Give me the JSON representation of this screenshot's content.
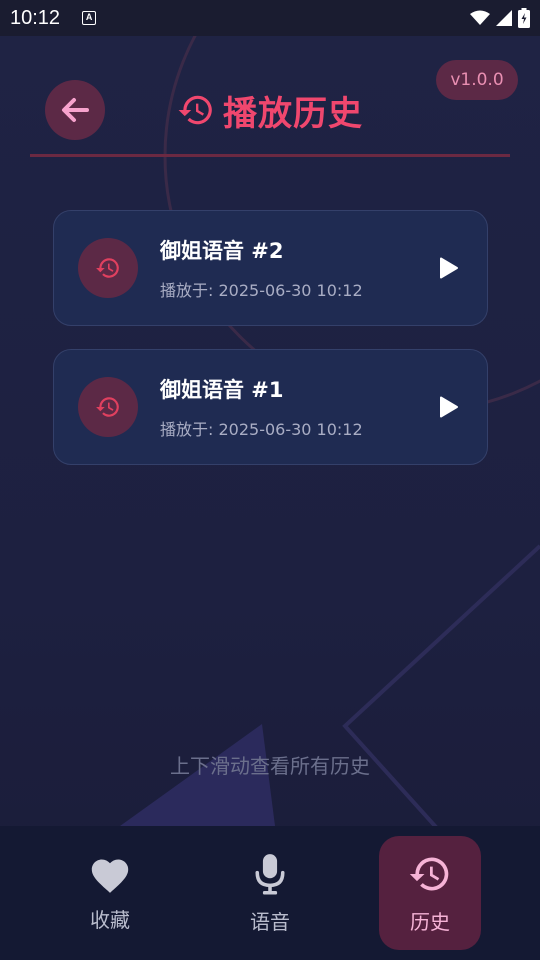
{
  "status_bar": {
    "time": "10:12",
    "a_glyph": "A",
    "icons": [
      "wifi-icon",
      "signal-icon",
      "battery-icon"
    ]
  },
  "header": {
    "title": "播放历史",
    "version": "v1.0.0",
    "back_icon": "arrow-left-icon",
    "title_icon": "history-icon"
  },
  "history": [
    {
      "title": "御姐语音 #2",
      "time": "播放于: 2025-06-30 10:12"
    },
    {
      "title": "御姐语音 #1",
      "time": "播放于: 2025-06-30 10:12"
    }
  ],
  "scroll_hint": "上下滑动查看所有历史",
  "nav": {
    "items": [
      {
        "label": "收藏",
        "icon": "heart-icon"
      },
      {
        "label": "语音",
        "icon": "microphone-icon"
      },
      {
        "label": "历史",
        "icon": "history-icon",
        "active": true
      }
    ]
  },
  "colors": {
    "accent": "#f0476e",
    "icon_bg": "#5c2946",
    "card_bg": "#1f2b52",
    "nav_bg": "#141933"
  }
}
